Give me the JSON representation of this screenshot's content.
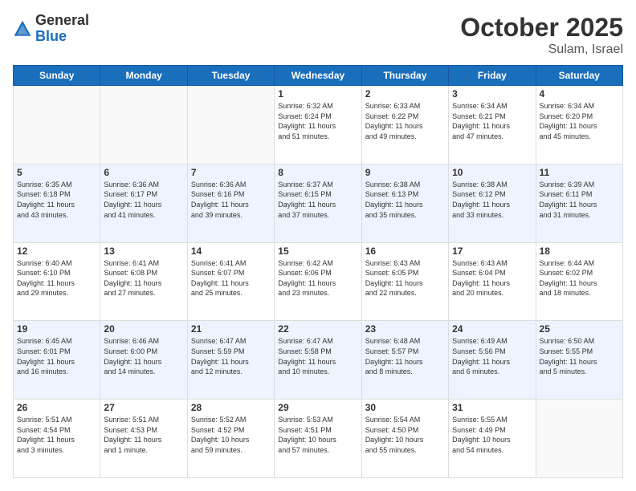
{
  "header": {
    "logo_general": "General",
    "logo_blue": "Blue",
    "month_title": "October 2025",
    "location": "Sulam, Israel"
  },
  "days_of_week": [
    "Sunday",
    "Monday",
    "Tuesday",
    "Wednesday",
    "Thursday",
    "Friday",
    "Saturday"
  ],
  "weeks": [
    [
      {
        "day": "",
        "info": ""
      },
      {
        "day": "",
        "info": ""
      },
      {
        "day": "",
        "info": ""
      },
      {
        "day": "1",
        "info": "Sunrise: 6:32 AM\nSunset: 6:24 PM\nDaylight: 11 hours\nand 51 minutes."
      },
      {
        "day": "2",
        "info": "Sunrise: 6:33 AM\nSunset: 6:22 PM\nDaylight: 11 hours\nand 49 minutes."
      },
      {
        "day": "3",
        "info": "Sunrise: 6:34 AM\nSunset: 6:21 PM\nDaylight: 11 hours\nand 47 minutes."
      },
      {
        "day": "4",
        "info": "Sunrise: 6:34 AM\nSunset: 6:20 PM\nDaylight: 11 hours\nand 45 minutes."
      }
    ],
    [
      {
        "day": "5",
        "info": "Sunrise: 6:35 AM\nSunset: 6:18 PM\nDaylight: 11 hours\nand 43 minutes."
      },
      {
        "day": "6",
        "info": "Sunrise: 6:36 AM\nSunset: 6:17 PM\nDaylight: 11 hours\nand 41 minutes."
      },
      {
        "day": "7",
        "info": "Sunrise: 6:36 AM\nSunset: 6:16 PM\nDaylight: 11 hours\nand 39 minutes."
      },
      {
        "day": "8",
        "info": "Sunrise: 6:37 AM\nSunset: 6:15 PM\nDaylight: 11 hours\nand 37 minutes."
      },
      {
        "day": "9",
        "info": "Sunrise: 6:38 AM\nSunset: 6:13 PM\nDaylight: 11 hours\nand 35 minutes."
      },
      {
        "day": "10",
        "info": "Sunrise: 6:38 AM\nSunset: 6:12 PM\nDaylight: 11 hours\nand 33 minutes."
      },
      {
        "day": "11",
        "info": "Sunrise: 6:39 AM\nSunset: 6:11 PM\nDaylight: 11 hours\nand 31 minutes."
      }
    ],
    [
      {
        "day": "12",
        "info": "Sunrise: 6:40 AM\nSunset: 6:10 PM\nDaylight: 11 hours\nand 29 minutes."
      },
      {
        "day": "13",
        "info": "Sunrise: 6:41 AM\nSunset: 6:08 PM\nDaylight: 11 hours\nand 27 minutes."
      },
      {
        "day": "14",
        "info": "Sunrise: 6:41 AM\nSunset: 6:07 PM\nDaylight: 11 hours\nand 25 minutes."
      },
      {
        "day": "15",
        "info": "Sunrise: 6:42 AM\nSunset: 6:06 PM\nDaylight: 11 hours\nand 23 minutes."
      },
      {
        "day": "16",
        "info": "Sunrise: 6:43 AM\nSunset: 6:05 PM\nDaylight: 11 hours\nand 22 minutes."
      },
      {
        "day": "17",
        "info": "Sunrise: 6:43 AM\nSunset: 6:04 PM\nDaylight: 11 hours\nand 20 minutes."
      },
      {
        "day": "18",
        "info": "Sunrise: 6:44 AM\nSunset: 6:02 PM\nDaylight: 11 hours\nand 18 minutes."
      }
    ],
    [
      {
        "day": "19",
        "info": "Sunrise: 6:45 AM\nSunset: 6:01 PM\nDaylight: 11 hours\nand 16 minutes."
      },
      {
        "day": "20",
        "info": "Sunrise: 6:46 AM\nSunset: 6:00 PM\nDaylight: 11 hours\nand 14 minutes."
      },
      {
        "day": "21",
        "info": "Sunrise: 6:47 AM\nSunset: 5:59 PM\nDaylight: 11 hours\nand 12 minutes."
      },
      {
        "day": "22",
        "info": "Sunrise: 6:47 AM\nSunset: 5:58 PM\nDaylight: 11 hours\nand 10 minutes."
      },
      {
        "day": "23",
        "info": "Sunrise: 6:48 AM\nSunset: 5:57 PM\nDaylight: 11 hours\nand 8 minutes."
      },
      {
        "day": "24",
        "info": "Sunrise: 6:49 AM\nSunset: 5:56 PM\nDaylight: 11 hours\nand 6 minutes."
      },
      {
        "day": "25",
        "info": "Sunrise: 6:50 AM\nSunset: 5:55 PM\nDaylight: 11 hours\nand 5 minutes."
      }
    ],
    [
      {
        "day": "26",
        "info": "Sunrise: 5:51 AM\nSunset: 4:54 PM\nDaylight: 11 hours\nand 3 minutes."
      },
      {
        "day": "27",
        "info": "Sunrise: 5:51 AM\nSunset: 4:53 PM\nDaylight: 11 hours\nand 1 minute."
      },
      {
        "day": "28",
        "info": "Sunrise: 5:52 AM\nSunset: 4:52 PM\nDaylight: 10 hours\nand 59 minutes."
      },
      {
        "day": "29",
        "info": "Sunrise: 5:53 AM\nSunset: 4:51 PM\nDaylight: 10 hours\nand 57 minutes."
      },
      {
        "day": "30",
        "info": "Sunrise: 5:54 AM\nSunset: 4:50 PM\nDaylight: 10 hours\nand 55 minutes."
      },
      {
        "day": "31",
        "info": "Sunrise: 5:55 AM\nSunset: 4:49 PM\nDaylight: 10 hours\nand 54 minutes."
      },
      {
        "day": "",
        "info": ""
      }
    ]
  ]
}
